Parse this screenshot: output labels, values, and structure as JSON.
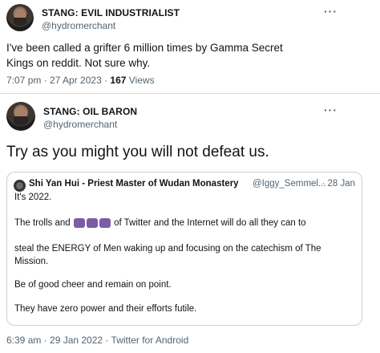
{
  "tweet1": {
    "name": "STANG: EVIL INDUSTRIALIST",
    "handle": "@hydromerchant",
    "more": "···",
    "text": "I've been called a grifter 6 million times by Gamma Secret Kings on reddit. Not sure why.",
    "time": "7:07 pm · 27 Apr 2023 · ",
    "views_count": "167",
    "views_label": " Views"
  },
  "tweet2": {
    "name": "STANG: OIL BARON",
    "handle": "@hydromerchant",
    "more": "···",
    "text": "Try as you might you will not defeat us.",
    "time": "6:39 am · 29 Jan 2022 · Twitter for Android"
  },
  "quote": {
    "name": "Shi Yan Hui - Priest Master of Wudan Monastery",
    "handle": "@Iggy_Semmel...",
    "date": "· 28 Jan",
    "line1": "It's 2022.",
    "line2a": "The trolls and ",
    "line2b": " of Twitter and the Internet will do all they can to",
    "line3": "steal the ENERGY of Men waking up and focusing on the catechism of The Mission.",
    "line4": "Be of good cheer and remain on point.",
    "line5": "They have zero power and their efforts futile."
  }
}
